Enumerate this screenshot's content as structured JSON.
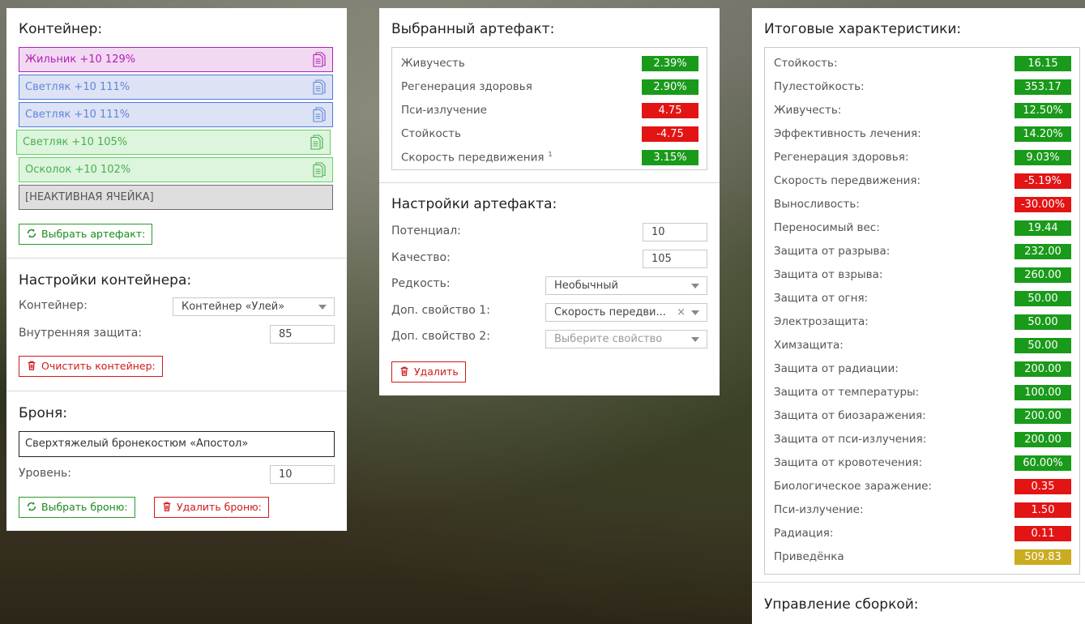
{
  "container": {
    "title": "Контейнер:",
    "slots": [
      {
        "label": "Жильник +10 129%",
        "style": "purple"
      },
      {
        "label": "Светляк +10 111%",
        "style": "blue"
      },
      {
        "label": "Светляк +10 111%",
        "style": "blue"
      },
      {
        "label": "Светляк +10 105%",
        "style": "green"
      },
      {
        "label": "Осколок +10 102%",
        "style": "green"
      },
      {
        "label": "[НЕАКТИВНАЯ ЯЧЕЙКА]",
        "style": "gray"
      }
    ],
    "select_artifact_button": "Выбрать артефакт:"
  },
  "container_settings": {
    "title": "Настройки контейнера:",
    "container_label": "Контейнер:",
    "container_value": "Контейнер «Улей»",
    "inner_protection_label": "Внутренняя защита:",
    "inner_protection_value": "85",
    "clear_button": "Очистить контейнер:"
  },
  "armor": {
    "title": "Броня:",
    "name": "Сверхтяжелый бронекостюм «Апостол»",
    "level_label": "Уровень:",
    "level_value": "10",
    "select_button": "Выбрать броню:",
    "delete_button": "Удалить броню:"
  },
  "selected_artifact": {
    "title": "Выбранный артефакт:",
    "stats": [
      {
        "name": "Живучесть",
        "value": "2.39%",
        "kind": "pos"
      },
      {
        "name": "Регенерация здоровья",
        "value": "2.90%",
        "kind": "pos"
      },
      {
        "name": "Пси-излучение",
        "value": "4.75",
        "kind": "neg"
      },
      {
        "name": "Стойкость",
        "value": "-4.75",
        "kind": "neg"
      },
      {
        "name": "Скорость передвижения",
        "value": "3.15%",
        "kind": "pos",
        "note": "1"
      }
    ]
  },
  "artifact_settings": {
    "title": "Настройки артефакта:",
    "potential_label": "Потенциал:",
    "potential_value": "10",
    "quality_label": "Качество:",
    "quality_value": "105",
    "rarity_label": "Редкость:",
    "rarity_value": "Необычный",
    "extra1_label": "Доп. свойство 1:",
    "extra1_value": "Скорость передви...",
    "extra2_label": "Доп. свойство 2:",
    "extra2_placeholder": "Выберите свойство",
    "delete_button": "Удалить"
  },
  "totals": {
    "title": "Итоговые характеристики:",
    "stats": [
      {
        "name": "Стойкость:",
        "value": "16.15",
        "kind": "pos"
      },
      {
        "name": "Пулестойкость:",
        "value": "353.17",
        "kind": "pos"
      },
      {
        "name": "Живучесть:",
        "value": "12.50%",
        "kind": "pos"
      },
      {
        "name": "Эффективность лечения:",
        "value": "14.20%",
        "kind": "pos"
      },
      {
        "name": "Регенерация здоровья:",
        "value": "9.03%",
        "kind": "pos"
      },
      {
        "name": "Скорость передвижения:",
        "value": "-5.19%",
        "kind": "neg"
      },
      {
        "name": "Выносливость:",
        "value": "-30.00%",
        "kind": "neg"
      },
      {
        "name": "Переносимый вес:",
        "value": "19.44",
        "kind": "pos"
      },
      {
        "name": "Защита от разрыва:",
        "value": "232.00",
        "kind": "pos"
      },
      {
        "name": "Защита от взрыва:",
        "value": "260.00",
        "kind": "pos"
      },
      {
        "name": "Защита от огня:",
        "value": "50.00",
        "kind": "pos"
      },
      {
        "name": "Электрозащита:",
        "value": "50.00",
        "kind": "pos"
      },
      {
        "name": "Химзащита:",
        "value": "50.00",
        "kind": "pos"
      },
      {
        "name": "Защита от радиации:",
        "value": "200.00",
        "kind": "pos"
      },
      {
        "name": "Защита от температуры:",
        "value": "100.00",
        "kind": "pos"
      },
      {
        "name": "Защита от биозаражения:",
        "value": "200.00",
        "kind": "pos"
      },
      {
        "name": "Защита от пси-излучения:",
        "value": "200.00",
        "kind": "pos"
      },
      {
        "name": "Защита от кровотечения:",
        "value": "60.00%",
        "kind": "pos"
      },
      {
        "name": "Биологическое заражение:",
        "value": "0.35",
        "kind": "neg"
      },
      {
        "name": "Пси-излучение:",
        "value": "1.50",
        "kind": "neg"
      },
      {
        "name": "Радиация:",
        "value": "0.11",
        "kind": "neg"
      },
      {
        "name": "Приведёнка",
        "value": "509.83",
        "kind": "gold"
      }
    ],
    "build_title": "Управление сборкой:"
  }
}
